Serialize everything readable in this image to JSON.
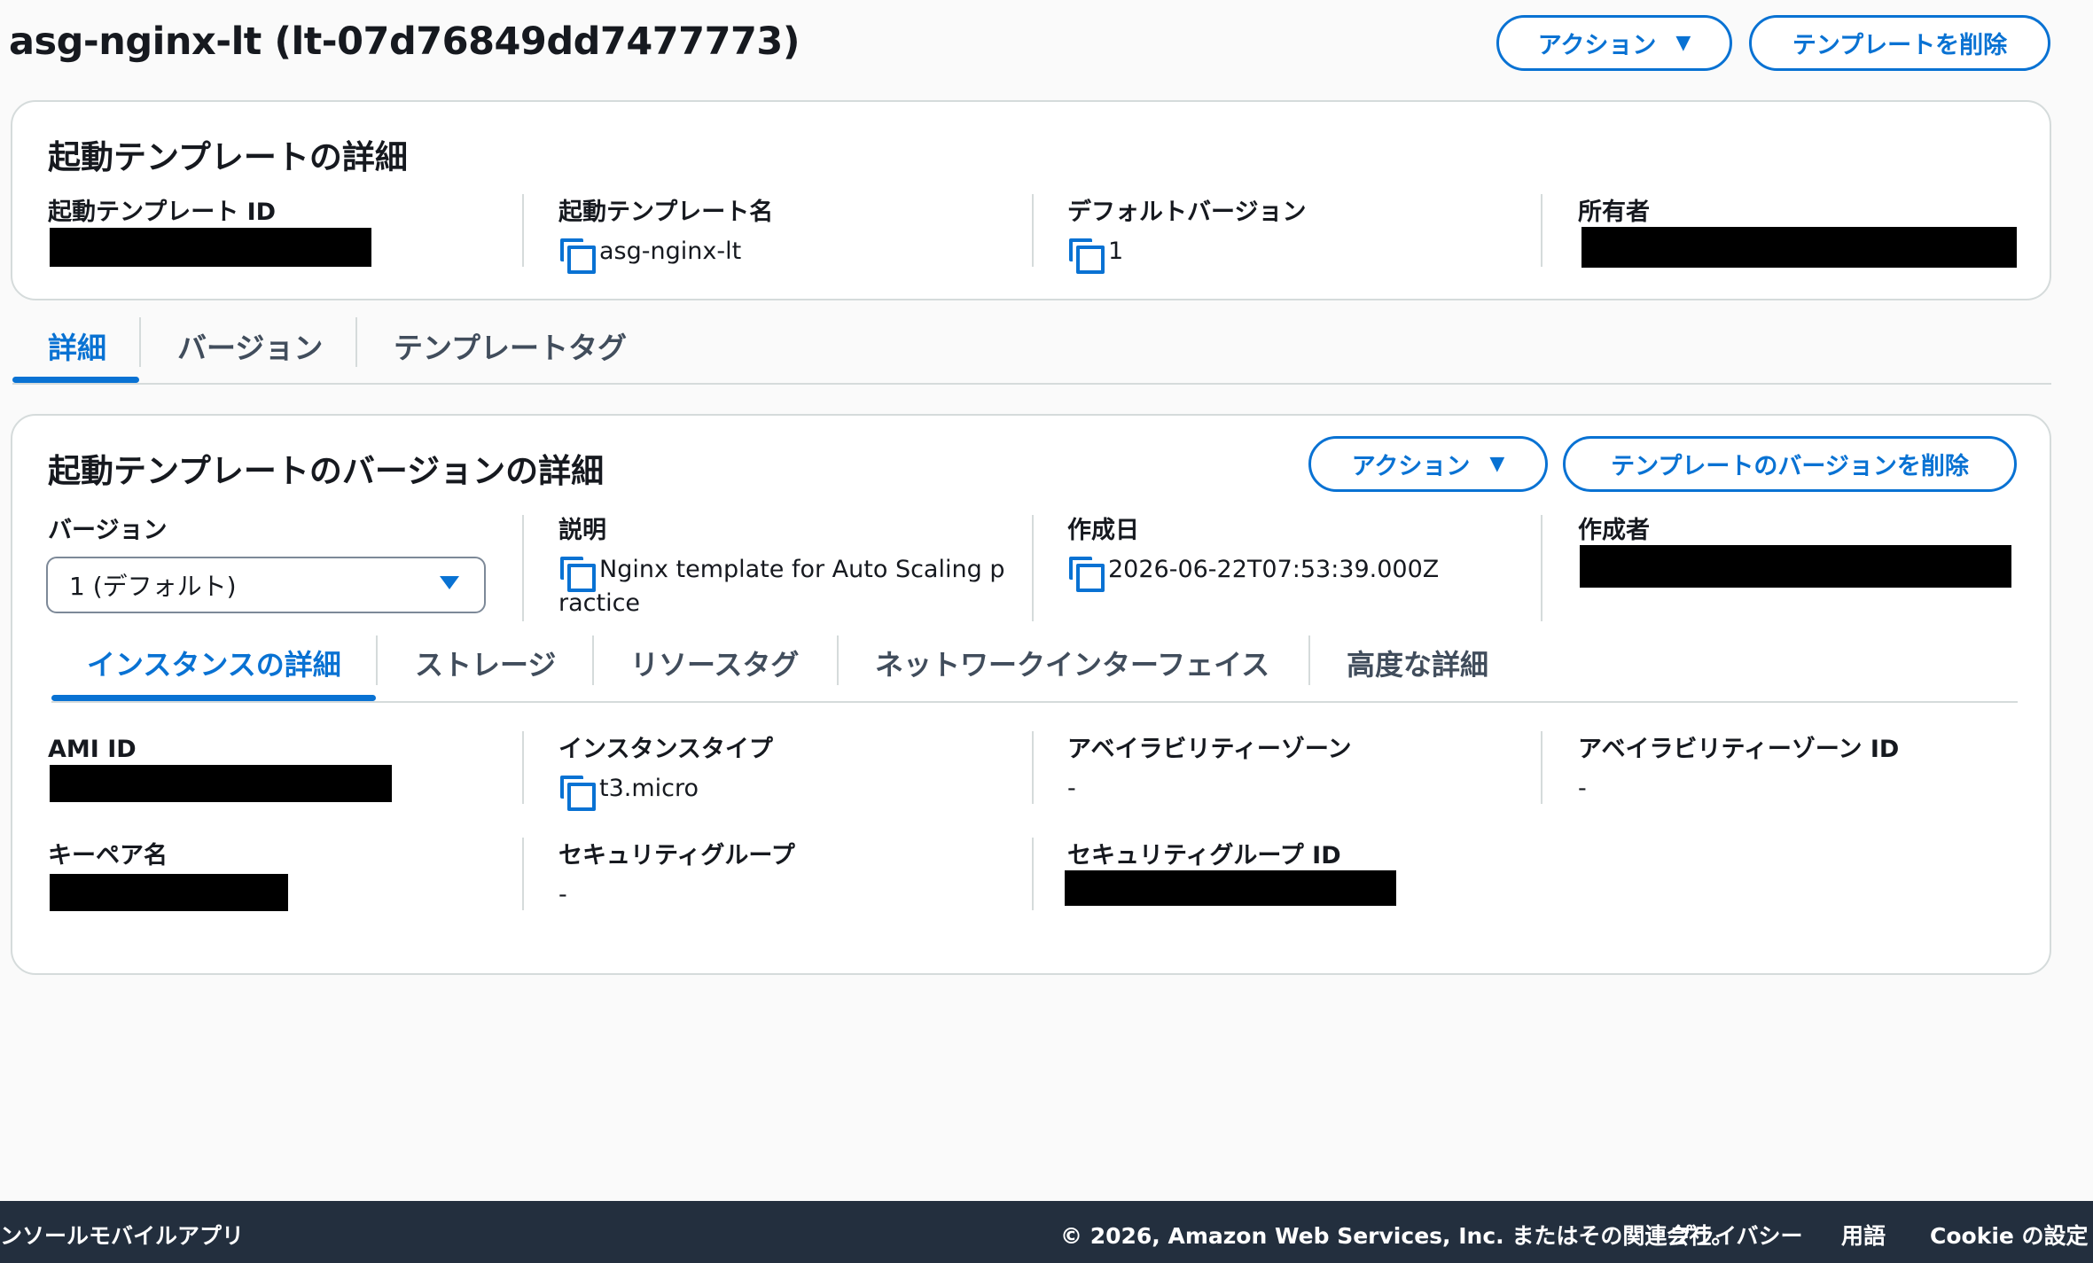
{
  "header": {
    "title": "asg-nginx-lt (lt-07d76849dd7477773)",
    "actions_label": "アクション",
    "delete_template_label": "テンプレートを削除"
  },
  "template_details": {
    "title": "起動テンプレートの詳細",
    "id_label": "起動テンプレート ID",
    "name_label": "起動テンプレート名",
    "name_value": "asg-nginx-lt",
    "default_version_label": "デフォルトバージョン",
    "default_version_value": "1",
    "owner_label": "所有者"
  },
  "tabs": [
    {
      "label": "詳細",
      "active": true
    },
    {
      "label": "バージョン",
      "active": false
    },
    {
      "label": "テンプレートタグ",
      "active": false
    }
  ],
  "version_details": {
    "title": "起動テンプレートのバージョンの詳細",
    "actions_label": "アクション",
    "delete_version_label": "テンプレートのバージョンを削除",
    "version_label": "バージョン",
    "version_selected": "1 (デフォルト)",
    "description_label": "説明",
    "description_value_line1": "Nginx template for Auto Scaling p",
    "description_value_line2": "ractice",
    "created_label": "作成日",
    "created_value": "2026-06-22T07:53:39.000Z",
    "creator_label": "作成者"
  },
  "sub_tabs": [
    {
      "label": "インスタンスの詳細",
      "active": true
    },
    {
      "label": "ストレージ",
      "active": false
    },
    {
      "label": "リソースタグ",
      "active": false
    },
    {
      "label": "ネットワークインターフェイス",
      "active": false
    },
    {
      "label": "高度な詳細",
      "active": false
    }
  ],
  "instance_details": {
    "ami_label": "AMI ID",
    "instance_type_label": "インスタンスタイプ",
    "instance_type_value": "t3.micro",
    "az_label": "アベイラビリティーゾーン",
    "az_value": "-",
    "az_id_label": "アベイラビリティーゾーン ID",
    "az_id_value": "-",
    "keypair_label": "キーペア名",
    "sg_label": "セキュリティグループ",
    "sg_value": "-",
    "sg_id_label": "セキュリティグループ ID"
  },
  "footer": {
    "mobile_app": "ンソールモバイルアプリ",
    "copyright": "© 2026, Amazon Web Services, Inc. またはその関連会社。",
    "privacy": "プライバシー",
    "terms": "用語",
    "cookie": "Cookie の設定"
  },
  "colors": {
    "accent": "#0972d3",
    "footer_bg": "#232f3e",
    "border": "#d5dbdb"
  }
}
